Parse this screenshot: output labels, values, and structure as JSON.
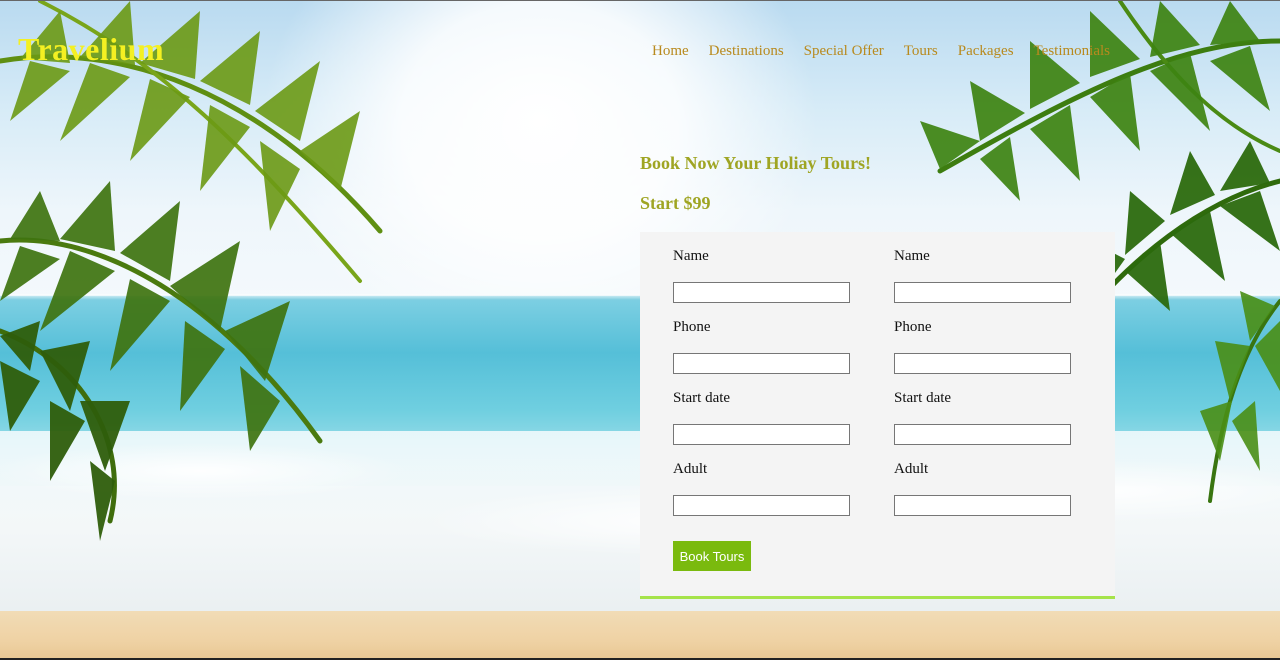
{
  "header": {
    "logo": "Travelium",
    "nav": [
      "Home",
      "Destinations",
      "Special Offer",
      "Tours",
      "Packages",
      "Testimonials"
    ]
  },
  "booking": {
    "title": "Book Now Your Holiay Tours!",
    "price": "Start $99",
    "left_column": {
      "name_label": "Name",
      "phone_label": "Phone",
      "start_date_label": "Start date",
      "adult_label": "Adult",
      "name_value": "",
      "phone_value": "",
      "start_date_value": "",
      "adult_value": ""
    },
    "right_column": {
      "name_label": "Name",
      "phone_label": "Phone",
      "start_date_label": "Start date",
      "adult_label": "Adult",
      "name_value": "",
      "phone_value": "",
      "start_date_value": "",
      "adult_value": ""
    },
    "submit_label": "Book Tours"
  },
  "colors": {
    "logo": "#f4f022",
    "nav_link": "#b88a1e",
    "heading": "#9fa523",
    "button": "#7aba0e",
    "card_border": "#a6e34a",
    "card_bg": "#f4f4f4"
  }
}
